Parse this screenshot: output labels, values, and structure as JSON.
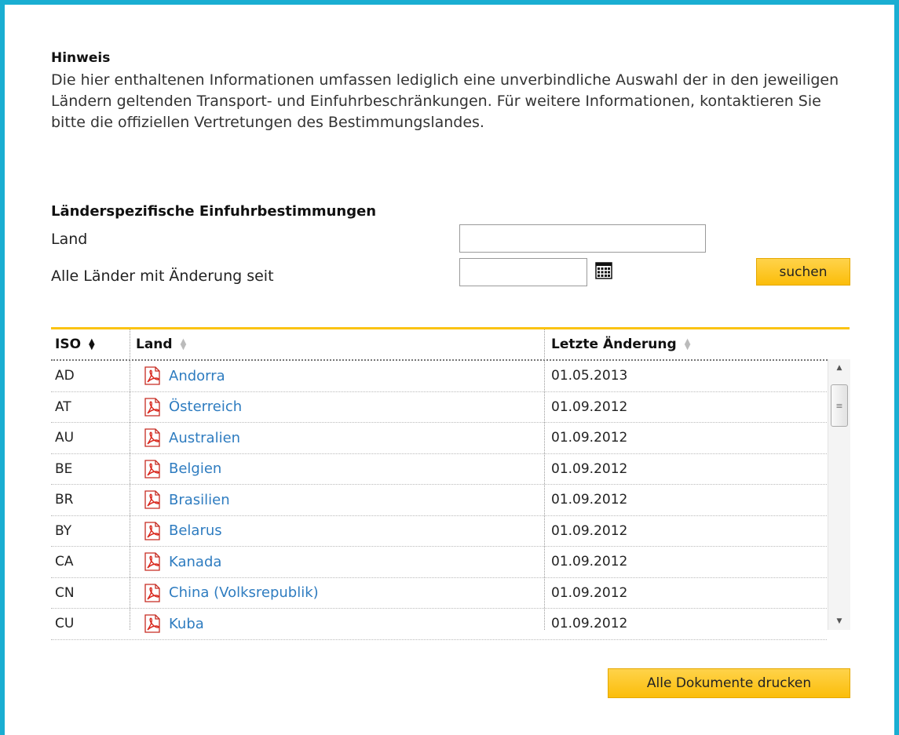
{
  "notice": {
    "title": "Hinweis",
    "text": "Die hier enthaltenen Informationen umfassen lediglich eine unverbindliche Auswahl der in den jeweiligen Ländern geltenden Transport- und Einfuhrbeschränkungen. Für weitere Informationen, kontaktieren Sie bitte die offiziellen Vertretungen des Bestimmungslandes."
  },
  "search": {
    "title": "Länderspezifische Einfuhrbestimmungen",
    "country_label": "Land",
    "country_value": "",
    "changed_since_label": "Alle Länder mit Änderung seit",
    "changed_since_value": "",
    "search_button": "suchen"
  },
  "table": {
    "columns": {
      "iso": "ISO",
      "country": "Land",
      "date": "Letzte Änderung"
    },
    "rows": [
      {
        "iso": "AD",
        "country": "Andorra",
        "date": "01.05.2013"
      },
      {
        "iso": "AT",
        "country": "Österreich",
        "date": "01.09.2012"
      },
      {
        "iso": "AU",
        "country": "Australien",
        "date": "01.09.2012"
      },
      {
        "iso": "BE",
        "country": "Belgien",
        "date": "01.09.2012"
      },
      {
        "iso": "BR",
        "country": "Brasilien",
        "date": "01.09.2012"
      },
      {
        "iso": "BY",
        "country": "Belarus",
        "date": "01.09.2012"
      },
      {
        "iso": "CA",
        "country": "Kanada",
        "date": "01.09.2012"
      },
      {
        "iso": "CN",
        "country": "China (Volksrepublik)",
        "date": "01.09.2012"
      },
      {
        "iso": "CU",
        "country": "Kuba",
        "date": "01.09.2012"
      }
    ]
  },
  "print_button": "Alle Dokumente drucken",
  "icons": {
    "document": "pdf-icon",
    "calendar": "calendar-icon"
  },
  "colors": {
    "frame": "#1aaed2",
    "accent": "#fbc313",
    "link": "#2e7cc0"
  }
}
